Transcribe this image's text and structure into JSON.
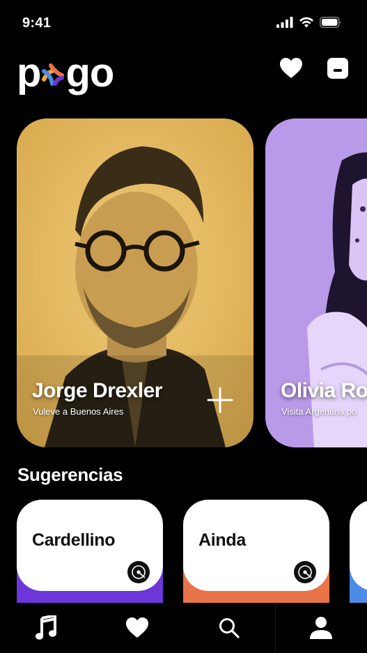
{
  "status_bar": {
    "time": "9:41",
    "icons": [
      "cellular-signal-icon",
      "wifi-icon",
      "battery-icon"
    ]
  },
  "header": {
    "logo_text_left": "p",
    "logo_text_right": "go",
    "logo_mark_colors": [
      "#f2a93b",
      "#e8744a",
      "#4d8be6",
      "#6c36d8"
    ],
    "actions": [
      "heart-icon",
      "chat-icon"
    ]
  },
  "featured": [
    {
      "title": "Jorge Drexler",
      "subtitle": "Vuleve a Buenos Aires",
      "tint": "#e6bd63",
      "action_icon": "plus-icon"
    },
    {
      "title": "Olivia Ro",
      "subtitle": "Visita Argentina po",
      "tint": "#b99ae8"
    }
  ],
  "suggestions": {
    "title": "Sugerencias",
    "items": [
      {
        "title": "Cardellino",
        "accent": "#6c36d8",
        "icon": "vinyl-record-icon"
      },
      {
        "title": "Ainda",
        "accent": "#e8744a",
        "icon": "vinyl-record-icon"
      },
      {
        "title": "",
        "accent": "#4d8be6",
        "icon": "vinyl-record-icon"
      }
    ]
  },
  "tab_bar": {
    "tabs": [
      "music-note-icon",
      "heart-icon",
      "search-icon",
      "profile-icon"
    ]
  },
  "colors": {
    "background": "#000000",
    "yellow": "#e6bd63",
    "lavender": "#b99ae8",
    "purple": "#6c36d8",
    "orange": "#e8744a",
    "blue": "#4d8be6"
  }
}
